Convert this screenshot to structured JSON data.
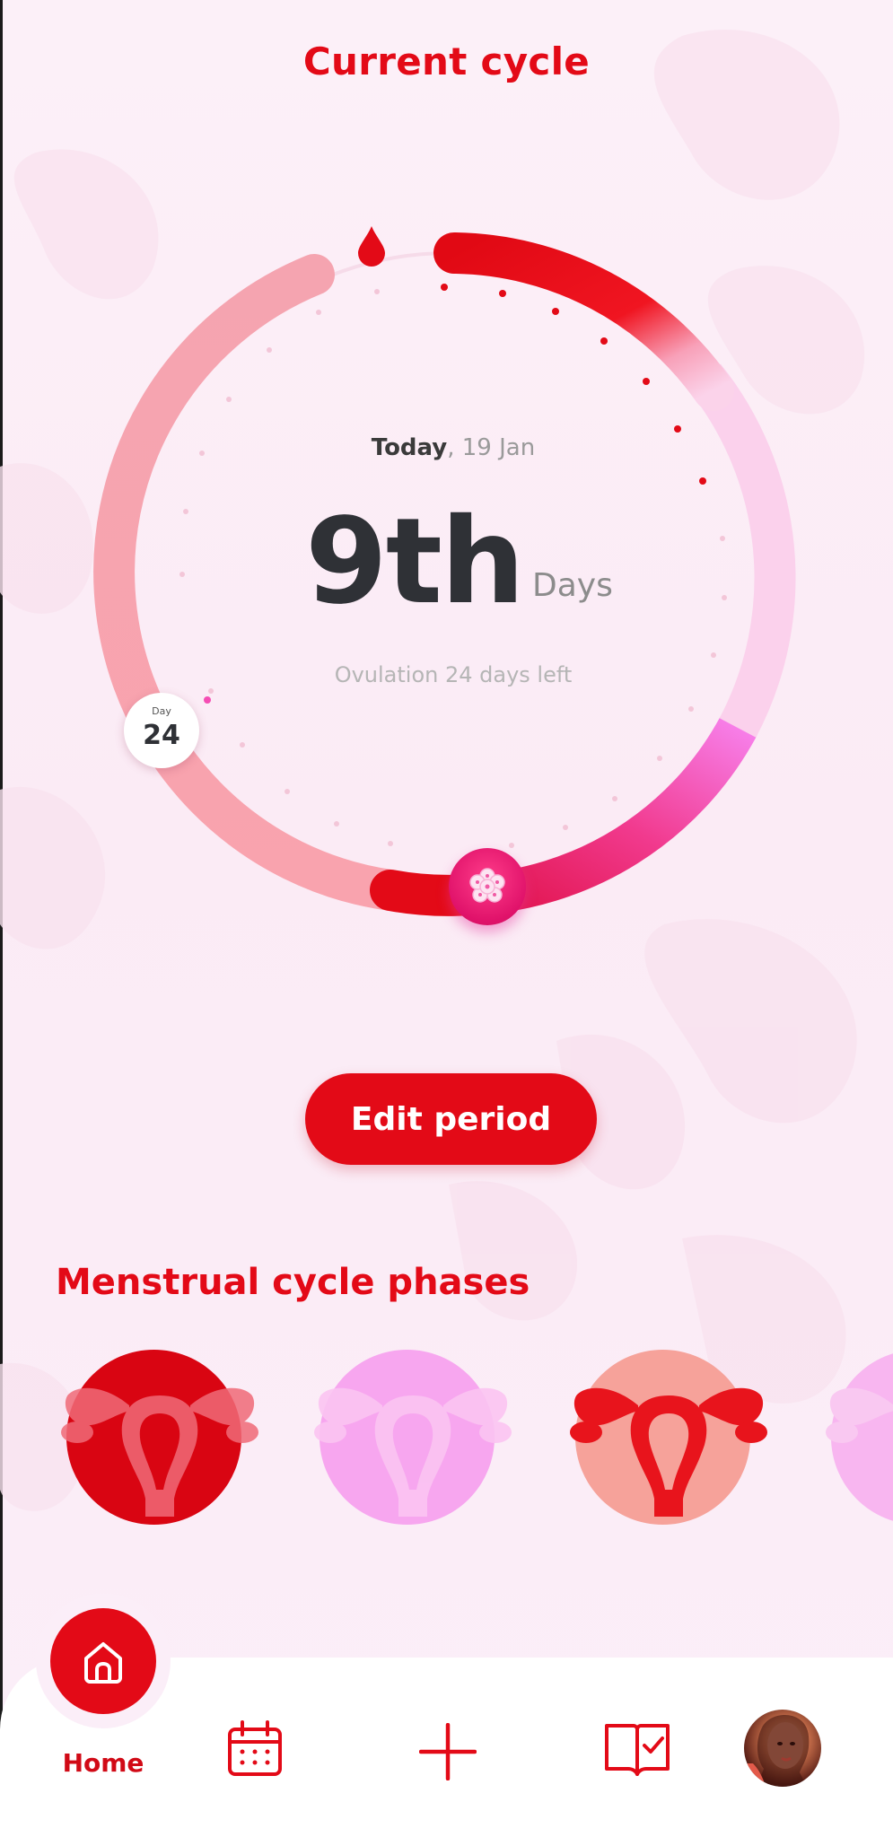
{
  "header": {
    "title": "Current cycle"
  },
  "cycle": {
    "today_label": "Today",
    "today_date": ", 19 Jan",
    "day_number": "9th",
    "day_unit": "Days",
    "ovulation_text": "Ovulation 24 days left",
    "marker_label": "Day",
    "marker_value": "24"
  },
  "actions": {
    "edit_label": "Edit period"
  },
  "phases": {
    "title": "Menstrual cycle phases",
    "items": [
      {
        "icon": "uterus-menstrual-icon",
        "circle_color": "#d90512",
        "uterus_color": "#f06a78"
      },
      {
        "icon": "uterus-follicular-icon",
        "circle_color": "#f7a6ef",
        "uterus_color": "#f9b8f0"
      },
      {
        "icon": "uterus-ovulation-icon",
        "circle_color": "#f6a29a",
        "uterus_color": "#e8141c"
      },
      {
        "icon": "uterus-luteal-icon",
        "circle_color": "#f8b6f0",
        "uterus_color": "#f7c3ef"
      }
    ]
  },
  "nav": {
    "home_label": "Home",
    "items": [
      "home-icon",
      "calendar-icon",
      "plus-icon",
      "journal-icon",
      "avatar"
    ]
  },
  "colors": {
    "accent": "#e30a17",
    "background": "#fbeef7"
  }
}
